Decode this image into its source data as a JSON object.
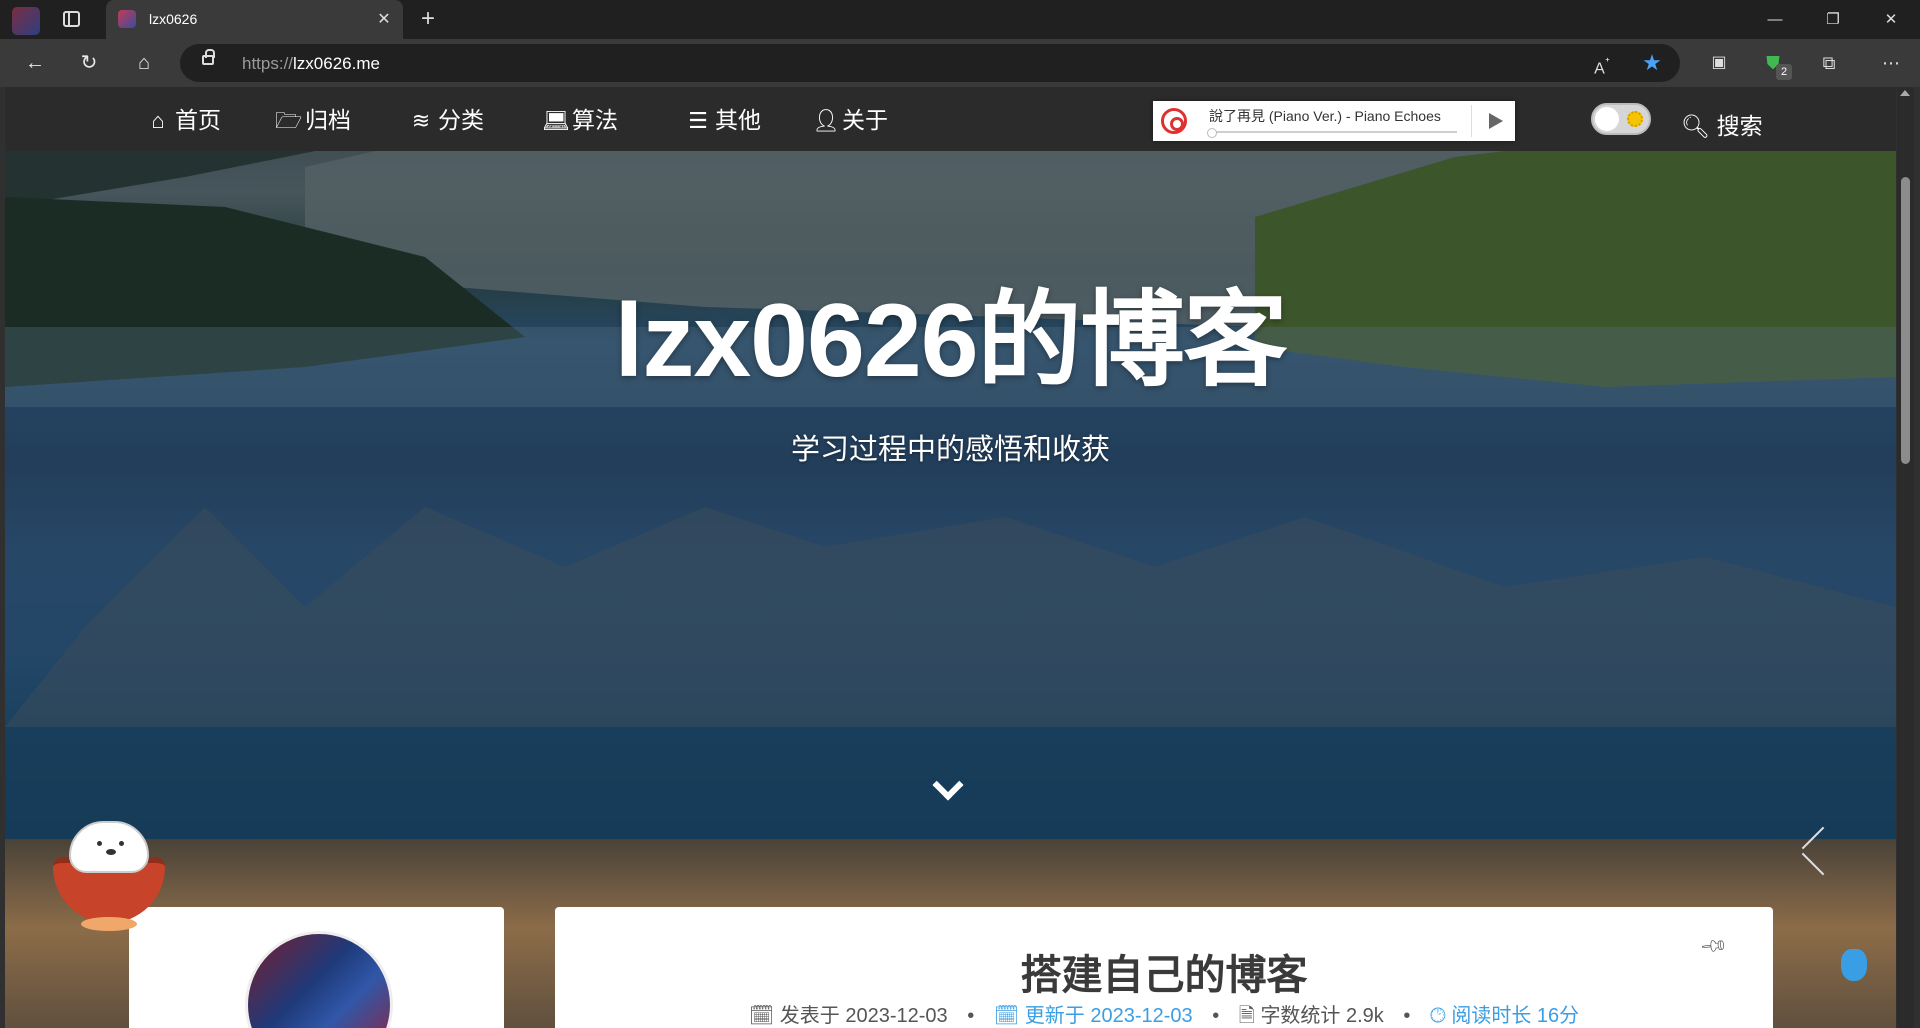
{
  "browser": {
    "tab_title": "lzx0626",
    "url_prefix": "https://",
    "url_host": "lzx0626.me",
    "extension_badge": "2",
    "icons": [
      "profile-icon",
      "tab-actions-icon",
      "favicon",
      "close-icon",
      "plus-icon",
      "minimize-icon",
      "restore-icon",
      "close-window-icon",
      "back-icon",
      "reload-icon",
      "home-icon",
      "lock-icon",
      "read-aloud-icon",
      "favorite-star-icon",
      "extension-icon",
      "shield-icon",
      "puzzle-icon",
      "more-icon"
    ],
    "colors": {
      "accent": "#4ba3f7",
      "frame": "#202020",
      "toolbar": "#3a3a3a"
    }
  },
  "nav": {
    "items": [
      {
        "label": "首页",
        "icon": "home-icon"
      },
      {
        "label": "归档",
        "icon": "folder-open-icon"
      },
      {
        "label": "分类",
        "icon": "layers-icon"
      },
      {
        "label": "算法",
        "icon": "laptop-icon"
      },
      {
        "label": "其他",
        "icon": "list-icon"
      },
      {
        "label": "关于",
        "icon": "user-icon"
      }
    ],
    "search_label": "搜索"
  },
  "player": {
    "title": "說了再見 (Piano Ver.) - Piano Echoes",
    "progress": 0
  },
  "hero": {
    "title": "lzx0626的博客",
    "subtitle": "学习过程中的感悟和收获"
  },
  "post": {
    "title": "搭建自己的博客",
    "published_label": "发表于 2023-12-03",
    "updated_label": "更新于 2023-12-03",
    "words_label": "字数统计 2.9k",
    "read_label": "阅读时长 16分",
    "separator": "•"
  },
  "colors": {
    "link_blue": "#3a9ee4",
    "title_text": "#3a3a3a",
    "topbar": "#2b2b2b"
  }
}
